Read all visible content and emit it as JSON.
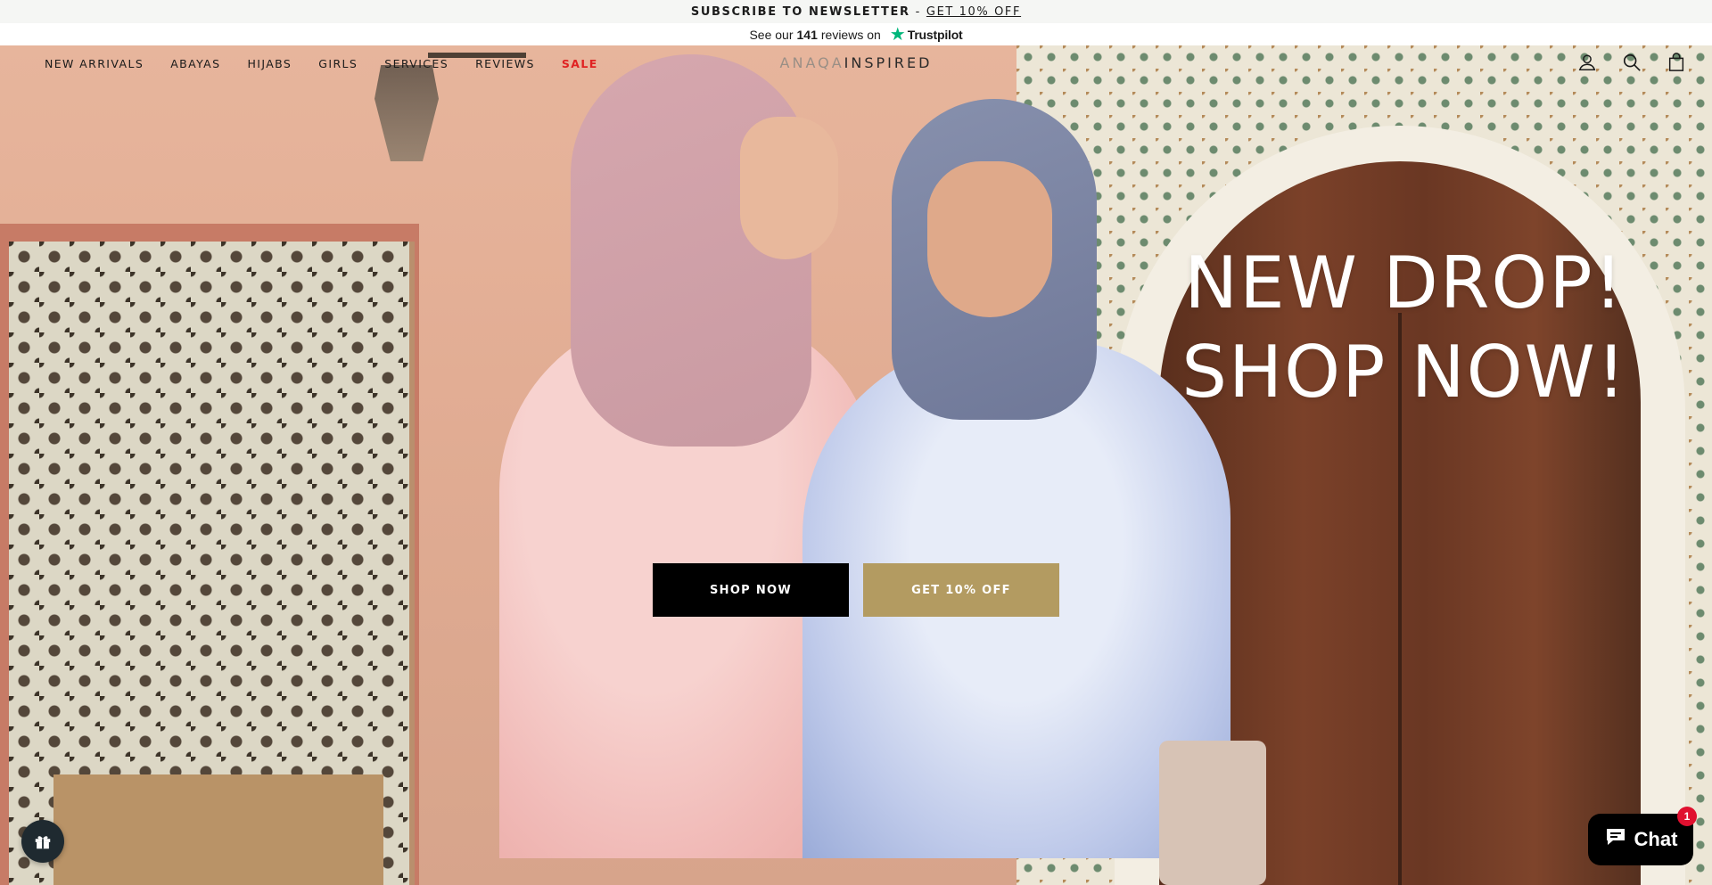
{
  "announcement": {
    "text": "SUBSCRIBE TO NEWSLETTER",
    "separator": "-",
    "link": "GET 10% OFF"
  },
  "trustpilot": {
    "prefix": "See our",
    "count": "141",
    "suffix": "reviews on",
    "brand": "Trustpilot",
    "star_color": "#00b67a"
  },
  "nav": {
    "items": [
      {
        "label": "NEW ARRIVALS"
      },
      {
        "label": "ABAYAS"
      },
      {
        "label": "HIJABS"
      },
      {
        "label": "GIRLS"
      },
      {
        "label": "SERVICES"
      },
      {
        "label": "REVIEWS"
      },
      {
        "label": "SALE",
        "color": "#e02222"
      }
    ],
    "logo_light": "ANAQA",
    "logo_dark": "INSPIRED",
    "icons": [
      "account-icon",
      "search-icon",
      "cart-icon"
    ]
  },
  "hero": {
    "title_line1": "NEW DROP!",
    "title_line2": "SHOP NOW!",
    "buttons": [
      {
        "label": "SHOP NOW",
        "color": "#000000"
      },
      {
        "label": "GET 10% OFF",
        "color": "#b39b61"
      }
    ]
  },
  "widgets": {
    "gift_icon": "gift-icon",
    "chat_label": "Chat",
    "chat_badge": "1",
    "chat_icon": "chat-bubble-icon"
  }
}
